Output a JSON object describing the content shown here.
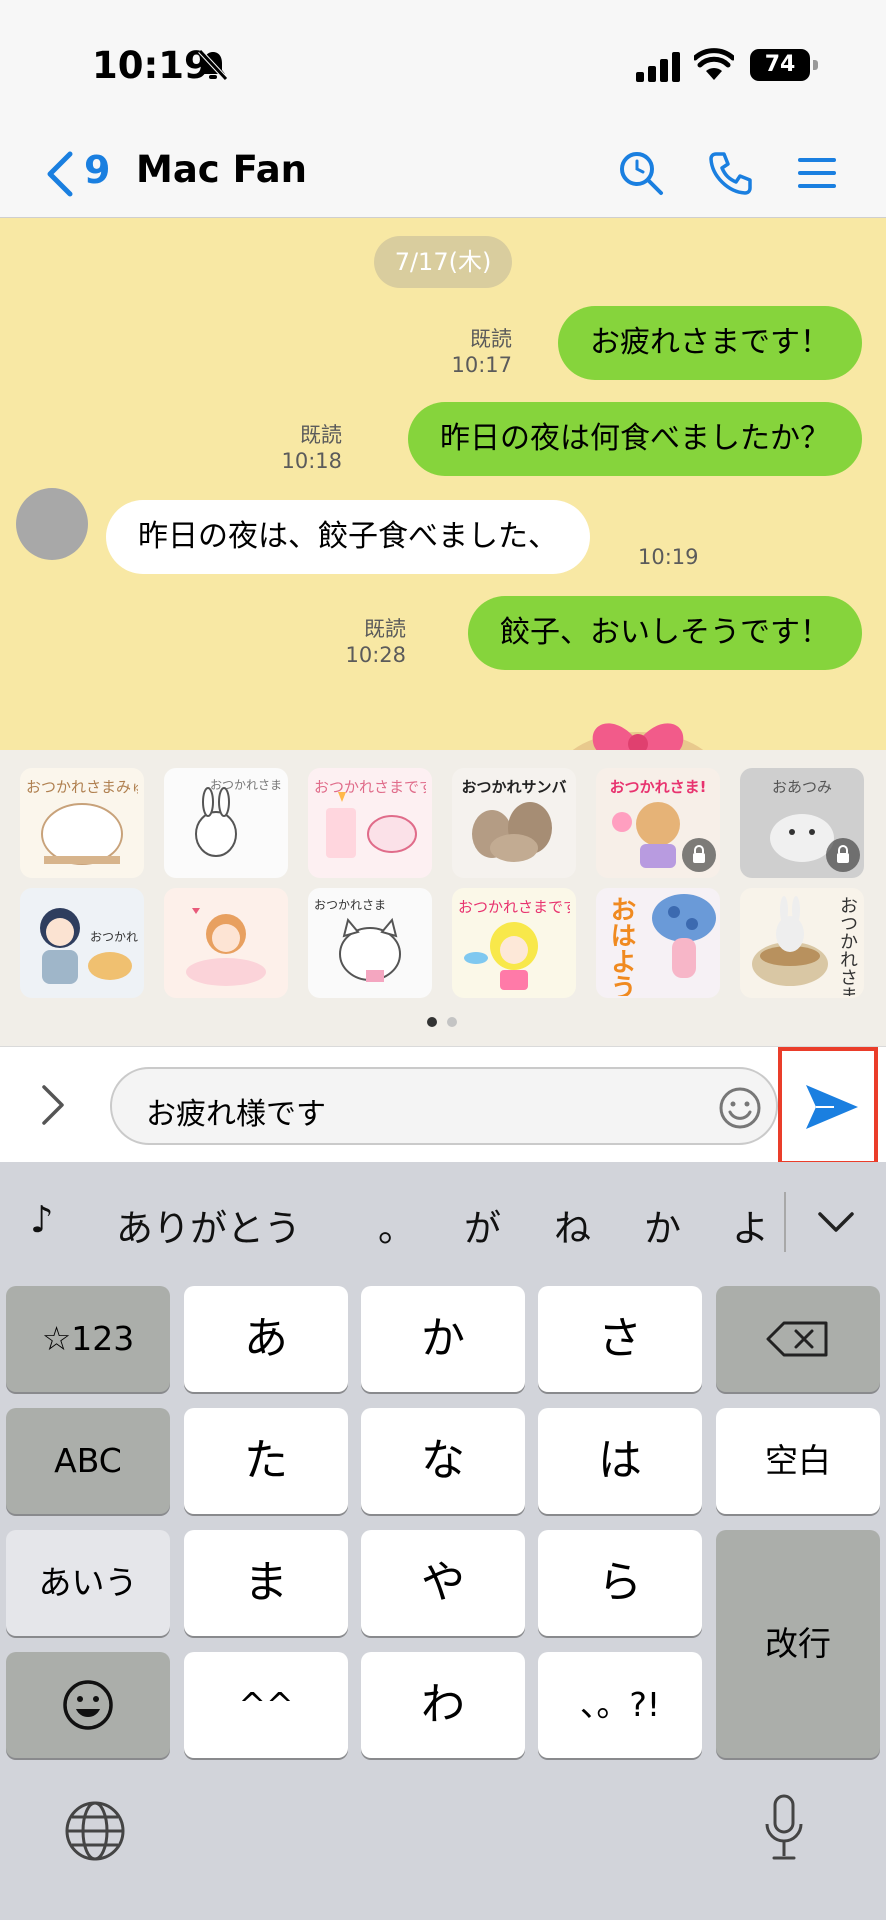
{
  "status_bar": {
    "time": "10:19",
    "battery": "74"
  },
  "nav": {
    "back_count": "9",
    "title": "Mac Fan"
  },
  "chat": {
    "date": "7/17(木)",
    "messages": [
      {
        "dir": "out",
        "text": "お疲れさまです！",
        "read": "既読",
        "time": "10:17"
      },
      {
        "dir": "out",
        "text": "昨日の夜は何食べましたか？",
        "read": "既読",
        "time": "10:18"
      },
      {
        "dir": "in",
        "text": "昨日の夜は、餃子食べました、",
        "time": "10:19"
      },
      {
        "dir": "out",
        "text": "餃子、おいしそうです！",
        "read": "既読",
        "time": "10:28"
      }
    ]
  },
  "stickers": [
    {
      "caption": "おつかれさまみゅん…",
      "bg": "#fbf6ec",
      "locked": false
    },
    {
      "caption": "おつかれさま",
      "bg": "#fbfbfb",
      "locked": false
    },
    {
      "caption": "おつかれさまです",
      "bg": "#fdf0f2",
      "locked": false
    },
    {
      "caption": "おつかれサンバ",
      "bg": "#f5f2ee",
      "locked": false
    },
    {
      "caption": "おつかれさま!",
      "bg": "#f7efe8",
      "locked": true
    },
    {
      "caption": "おあつみ",
      "bg": "#cfcfcf",
      "locked": true
    },
    {
      "caption": "おつかれ",
      "bg": "#eef2f6",
      "locked": false
    },
    {
      "caption": "",
      "bg": "#fdf0ea",
      "locked": false
    },
    {
      "caption": "おつかれさま",
      "bg": "#fafafa",
      "locked": false
    },
    {
      "caption": "おつかれさまです",
      "bg": "#fbf8e8",
      "locked": false
    },
    {
      "caption": "おはよう",
      "bg": "#f6f1f5",
      "locked": false
    },
    {
      "caption": "おつかれさま",
      "bg": "#f8f3ea",
      "locked": false
    }
  ],
  "input": {
    "value": "お疲れ様です"
  },
  "keyboard": {
    "candidates": [
      "♪",
      "ありがとう",
      "。",
      "が",
      "ね",
      "か",
      "よ"
    ],
    "keys": {
      "num": "☆123",
      "a": "あ",
      "ka": "か",
      "sa": "さ",
      "abc": "ABC",
      "ta": "た",
      "na": "な",
      "ha": "は",
      "space": "空白",
      "aiu": "あいう",
      "ma": "ま",
      "ya": "や",
      "ra": "ら",
      "enter": "改行",
      "kao": "^^",
      "wa": "わ",
      "punct": "、。?!"
    }
  },
  "colors": {
    "accent": "#1a7fe0",
    "bubble_out": "#86d43c",
    "chat_bg": "#f8e8a4",
    "highlight": "#ea3d2a"
  }
}
